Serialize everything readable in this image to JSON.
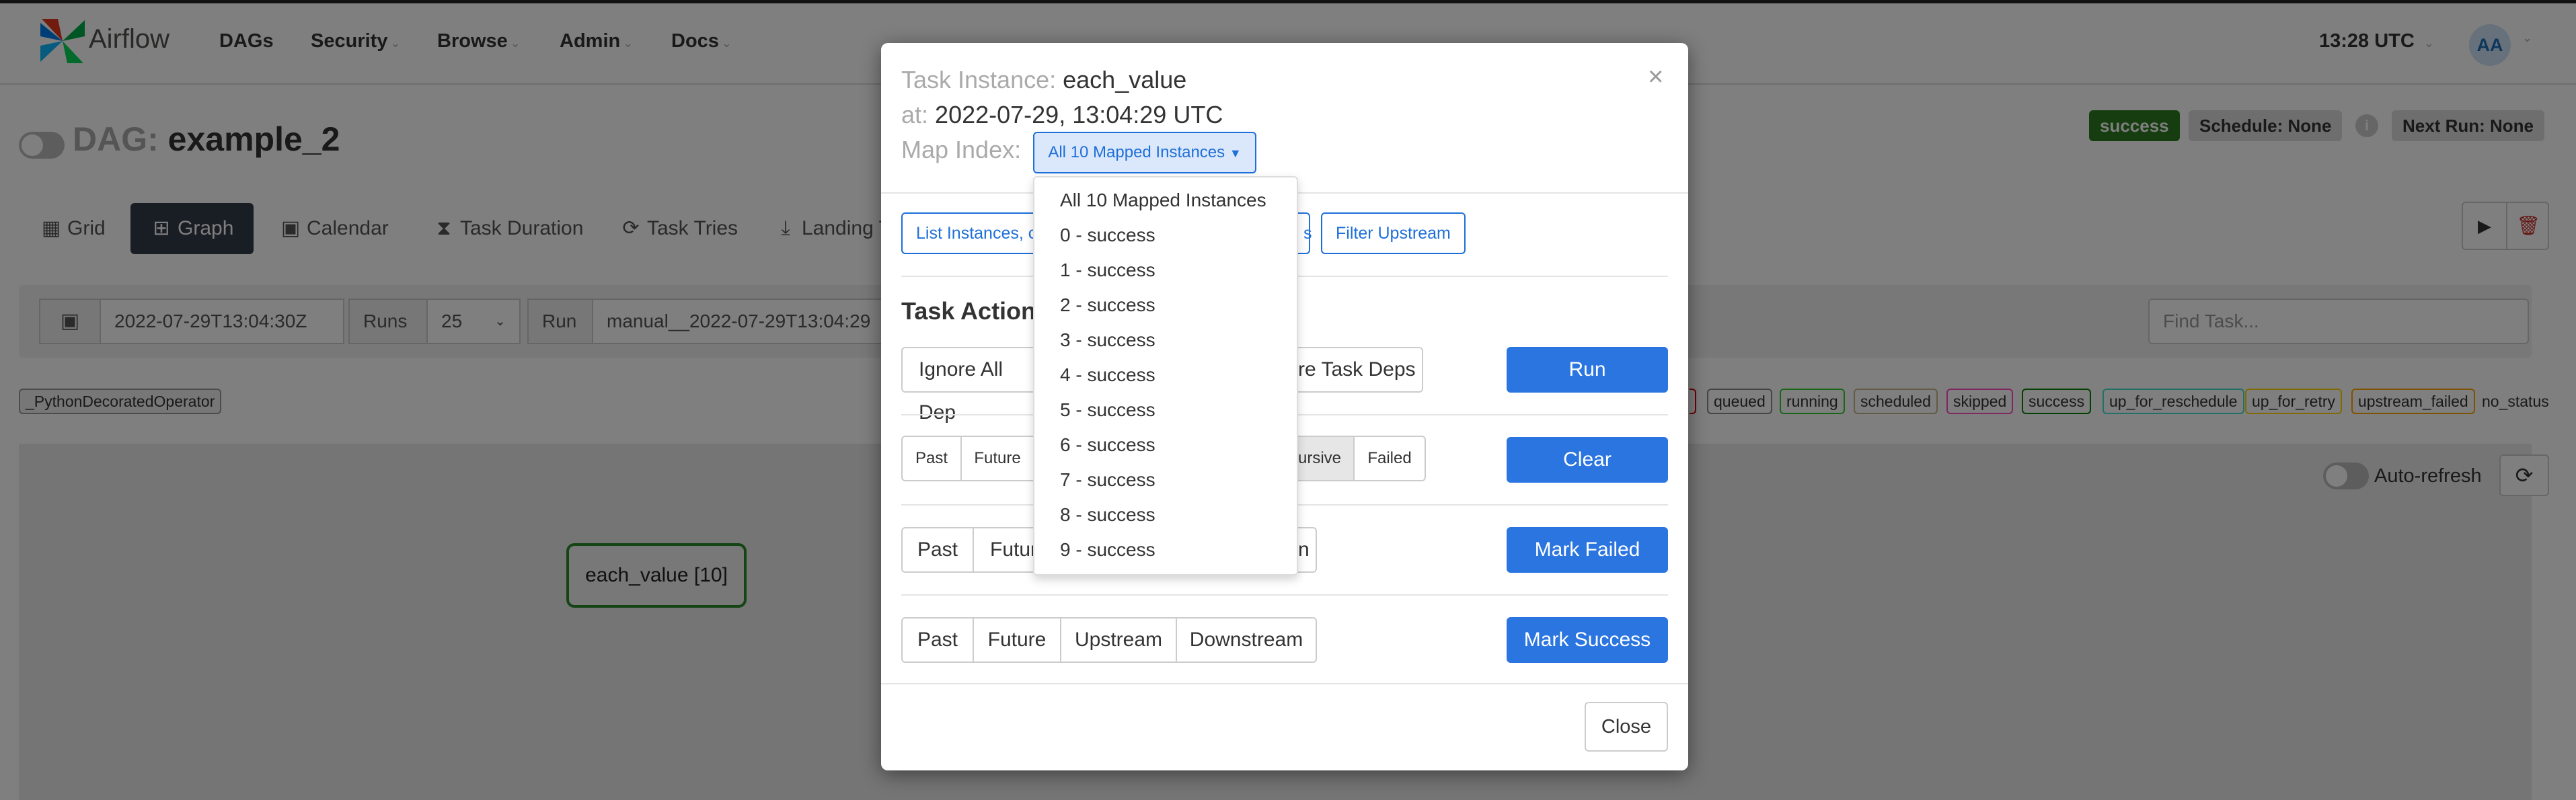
{
  "navbar": {
    "brand": "Airflow",
    "items": [
      {
        "label": "DAGs",
        "has_caret": false
      },
      {
        "label": "Security",
        "has_caret": true
      },
      {
        "label": "Browse",
        "has_caret": true
      },
      {
        "label": "Admin",
        "has_caret": true
      },
      {
        "label": "Docs",
        "has_caret": true
      }
    ],
    "time": "13:28 UTC",
    "avatar": "AA",
    "caret": "⌄"
  },
  "dag": {
    "prefix": "DAG:",
    "name": "example_2",
    "status_badge": "success",
    "schedule": "Schedule: None",
    "next_run": "Next Run: None",
    "info_icon": "i"
  },
  "tabs": [
    "Grid",
    "Graph",
    "Calendar",
    "Task Duration",
    "Task Tries",
    "Landing Times"
  ],
  "controls": {
    "date_value": "2022-07-29T13:04:30Z",
    "runs_label": "Runs",
    "runs_value": "25",
    "run_label": "Run",
    "run_value": "manual__2022-07-29T13:04:29",
    "find_task_placeholder": "Find Task...",
    "operator_legend": "_PythonDecoratedOperator"
  },
  "legend": [
    "queued",
    "running",
    "scheduled",
    "skipped",
    "success",
    "up_for_reschedule",
    "up_for_retry",
    "upstream_failed",
    "no_status"
  ],
  "graph": {
    "auto_refresh": "Auto-refresh",
    "node_label": "each_value [10]"
  },
  "modal": {
    "task_instance_label": "Task Instance:",
    "task_instance": "each_value",
    "at_label": "at:",
    "at_value": "2022-07-29, 13:04:29 UTC",
    "map_index_label": "Map Index:",
    "map_index_selected": "All 10 Mapped Instances",
    "close_x": "×",
    "link_buttons": [
      "List Instances, c",
      "s",
      "Filter Upstream"
    ],
    "task_actions_title": "Task Actions",
    "ignore_all_deps": "Ignore All Dep",
    "ignore_task_deps": "re Task Deps",
    "run": "Run",
    "clear_options": {
      "past": "Past",
      "future": "Future",
      "recursive": "ursive",
      "failed": "Failed"
    },
    "clear": "Clear",
    "failed_options": {
      "past": "Past",
      "future": "Futur",
      "downstream": "n"
    },
    "mark_failed": "Mark Failed",
    "success_options": {
      "past": "Past",
      "future": "Future",
      "upstream": "Upstream",
      "downstream": "Downstream"
    },
    "mark_success": "Mark Success",
    "close": "Close"
  },
  "map_index_menu": [
    "All 10 Mapped Instances",
    "0 - success",
    "1 - success",
    "2 - success",
    "3 - success",
    "4 - success",
    "5 - success",
    "6 - success",
    "7 - success",
    "8 - success",
    "9 - success"
  ],
  "colors": {
    "primary": "#2b75e0",
    "success": "#2b8a2b",
    "nav_dark": "#333a49"
  }
}
